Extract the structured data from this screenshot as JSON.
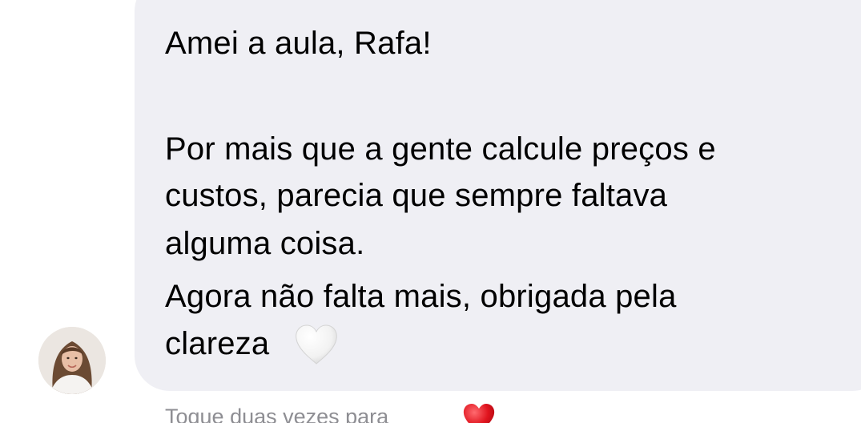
{
  "message": {
    "lines": [
      "Amei a aula, Rafa!",
      "Por mais que a gente calcule preços e",
      "custos, parecia que sempre faltava",
      "alguma coisa.",
      "Agora não falta mais, obrigada pela",
      "clareza"
    ],
    "emoji_icon": "white-heart-icon"
  },
  "sender": {
    "avatar_icon": "profile-photo-avatar"
  },
  "footer": {
    "hint_text": "Toque duas vezes para",
    "emoji_icon": "red-heart-icon"
  },
  "colors": {
    "bubble": "#efeff4",
    "text": "#000000",
    "hint": "#8e8e93",
    "heart_red": "#e0141e"
  }
}
